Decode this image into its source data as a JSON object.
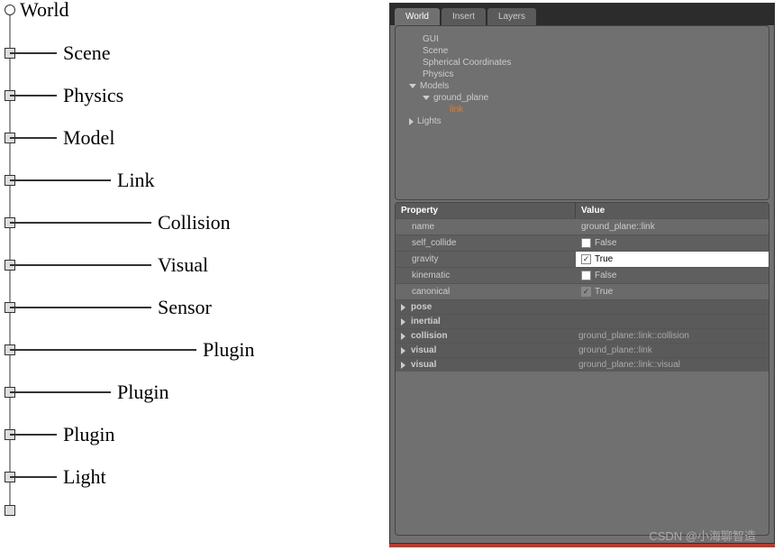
{
  "hierarchy": {
    "root": "World",
    "items": [
      {
        "label": "Scene",
        "indent": 70
      },
      {
        "label": "Physics",
        "indent": 70
      },
      {
        "label": "Model",
        "indent": 70
      },
      {
        "label": "Link",
        "indent": 130
      },
      {
        "label": "Collision",
        "indent": 175
      },
      {
        "label": "Visual",
        "indent": 175
      },
      {
        "label": "Sensor",
        "indent": 175
      },
      {
        "label": "Plugin",
        "indent": 225
      },
      {
        "label": "Plugin",
        "indent": 130
      },
      {
        "label": "Plugin",
        "indent": 70
      },
      {
        "label": "Light",
        "indent": 70
      }
    ]
  },
  "panel": {
    "tabs": [
      "World",
      "Insert",
      "Layers"
    ],
    "tree": {
      "gui": "GUI",
      "scene": "Scene",
      "spherical": "Spherical Coordinates",
      "physics": "Physics",
      "models": "Models",
      "ground_plane": "ground_plane",
      "link": "link",
      "lights": "Lights"
    },
    "properties": {
      "header_key": "Property",
      "header_val": "Value",
      "rows": [
        {
          "key": "name",
          "val": "ground_plane::link"
        },
        {
          "key": "self_collide",
          "val": "False",
          "check": false
        },
        {
          "key": "gravity",
          "val": "True",
          "check": true,
          "selected": true
        },
        {
          "key": "kinematic",
          "val": "False",
          "check": false
        },
        {
          "key": "canonical",
          "val": "True",
          "check": true,
          "disabled": true
        }
      ],
      "expand_rows": [
        {
          "key": "pose",
          "val": ""
        },
        {
          "key": "inertial",
          "val": ""
        },
        {
          "key": "collision",
          "val": "ground_plane::link::collision"
        },
        {
          "key": "visual",
          "val": "ground_plane::link"
        },
        {
          "key": "visual",
          "val": "ground_plane::link::visual"
        }
      ]
    }
  },
  "watermark": "CSDN @小海聊智造"
}
